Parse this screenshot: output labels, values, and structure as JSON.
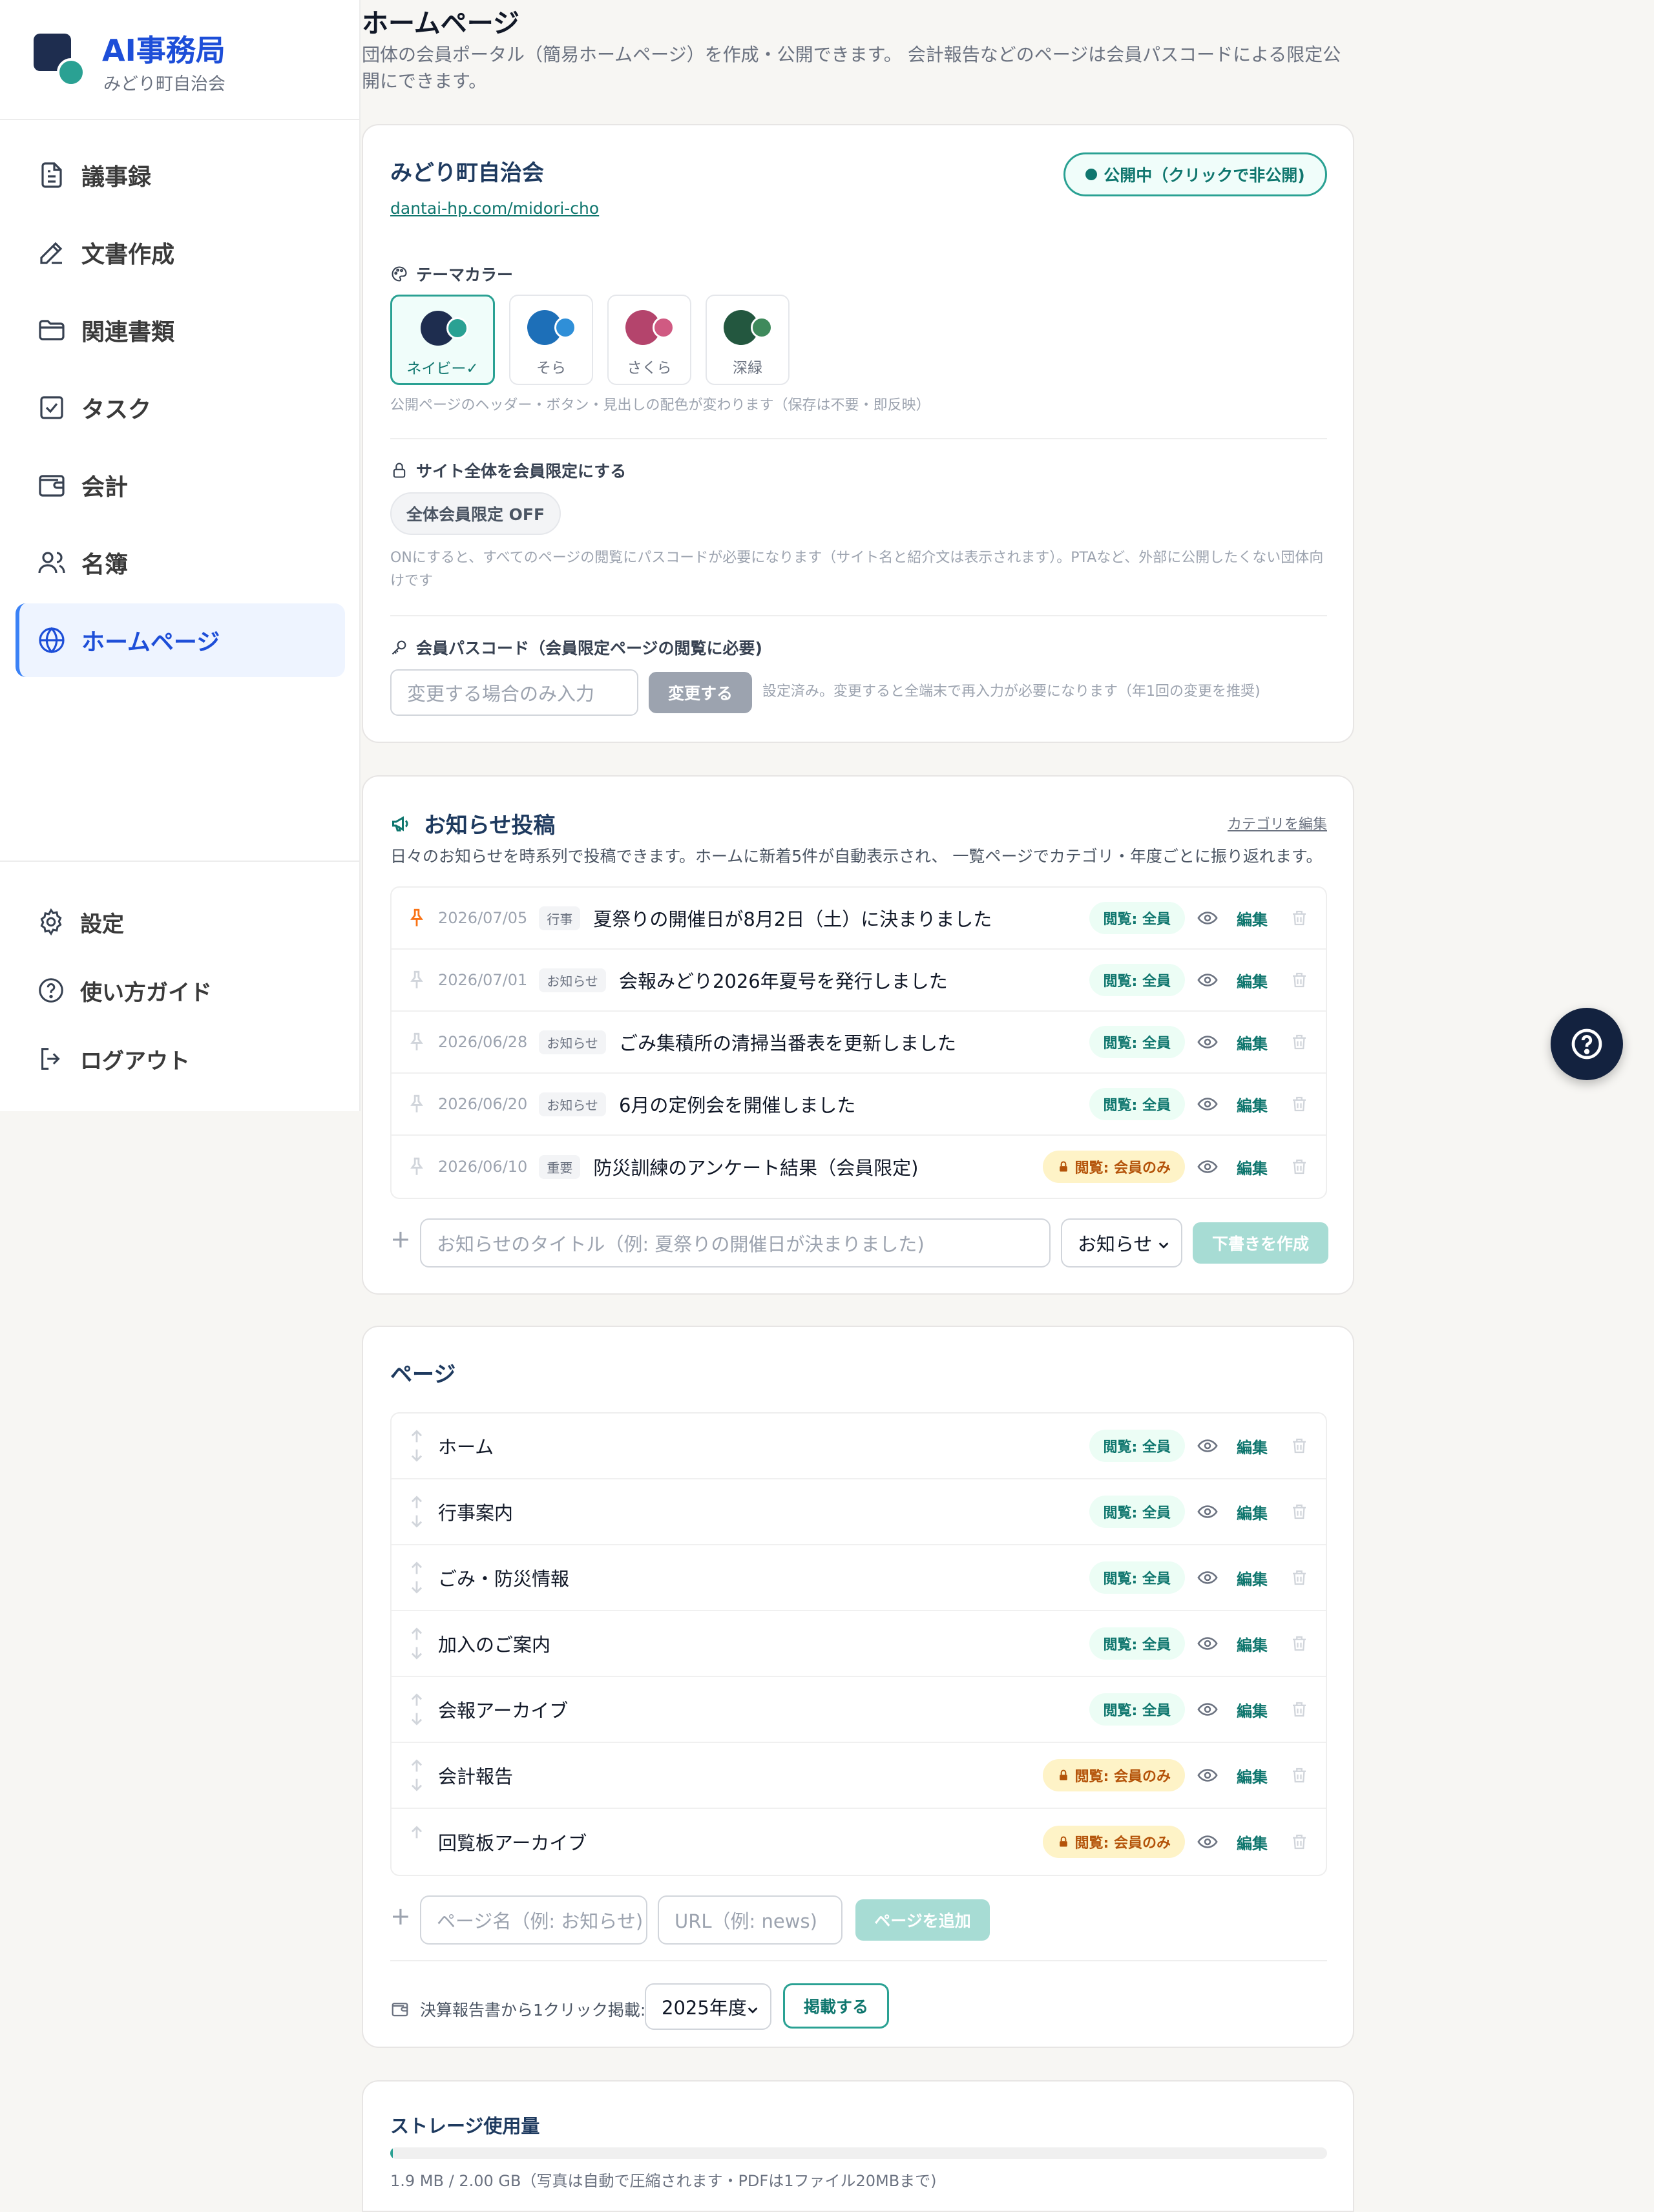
{
  "sidebar": {
    "brand": {
      "title": "AI事務局",
      "subtitle": "みどり町自治会"
    },
    "items": [
      {
        "label": "議事録",
        "icon": "document-icon"
      },
      {
        "label": "文書作成",
        "icon": "pen-icon"
      },
      {
        "label": "関連書類",
        "icon": "folder-icon"
      },
      {
        "label": "タスク",
        "icon": "checkbox-icon"
      },
      {
        "label": "会計",
        "icon": "wallet-icon"
      },
      {
        "label": "名簿",
        "icon": "users-icon"
      },
      {
        "label": "ホームページ",
        "icon": "globe-icon",
        "active": true
      }
    ],
    "bottom_items": [
      {
        "label": "設定",
        "icon": "gear-icon"
      },
      {
        "label": "使い方ガイド",
        "icon": "help-circle-icon"
      },
      {
        "label": "ログアウト",
        "icon": "logout-icon"
      }
    ]
  },
  "header": {
    "title": "ホームページ",
    "description": "団体の会員ポータル（簡易ホームページ）を作成・公開できます。 会計報告などのページは会員パスコードによる限定公開にできます。"
  },
  "site": {
    "name": "みどり町自治会",
    "url": "dantai-hp.com/midori-cho",
    "publish_label": "公開中（クリックで非公開)",
    "theme_label": "テーマカラー",
    "themes": [
      {
        "label": "ネイビー✓",
        "primary": "#1e2d4f",
        "accent": "#2aa193",
        "selected": true
      },
      {
        "label": "そら",
        "primary": "#1d6fb8",
        "accent": "#2f8fd8"
      },
      {
        "label": "さくら",
        "primary": "#b4446c",
        "accent": "#d05a82"
      },
      {
        "label": "深緑",
        "primary": "#23573f",
        "accent": "#3f8a5c"
      }
    ],
    "theme_hint": "公開ページのヘッダー・ボタン・見出しの配色が変わります（保存は不要・即反映）",
    "member_only_label": "サイト全体を会員限定にする",
    "member_only_toggle": "全体会員限定 OFF",
    "member_only_hint": "ONにすると、すべてのページの閲覧にパスコードが必要になります（サイト名と紹介文は表示されます）。PTAなど、外部に公開したくない団体向けです",
    "passcode_label": "会員パスコード（会員限定ページの閲覧に必要)",
    "passcode_placeholder": "変更する場合のみ入力",
    "passcode_button": "変更する",
    "passcode_hint": "設定済み。変更すると全端末で再入力が必要になります（年1回の変更を推奨)"
  },
  "news": {
    "title": "お知らせ投稿",
    "edit_categories": "カテゴリを編集",
    "description": "日々のお知らせを時系列で投稿できます。ホームに新着5件が自動表示され、 一覧ページでカテゴリ・年度ごとに振り返れます。",
    "items": [
      {
        "date": "2026/07/05",
        "category": "行事",
        "title": "夏祭りの開催日が8月2日（土）に決まりました",
        "access": "閲覧: 全員",
        "member_only": false,
        "pinned": true
      },
      {
        "date": "2026/07/01",
        "category": "お知らせ",
        "title": "会報みどり2026年夏号を発行しました",
        "access": "閲覧: 全員",
        "member_only": false,
        "pinned": false
      },
      {
        "date": "2026/06/28",
        "category": "お知らせ",
        "title": "ごみ集積所の清掃当番表を更新しました",
        "access": "閲覧: 全員",
        "member_only": false,
        "pinned": false
      },
      {
        "date": "2026/06/20",
        "category": "お知らせ",
        "title": "6月の定例会を開催しました",
        "access": "閲覧: 全員",
        "member_only": false,
        "pinned": false
      },
      {
        "date": "2026/06/10",
        "category": "重要",
        "title": "防災訓練のアンケート結果（会員限定)",
        "access": "閲覧: 会員のみ",
        "member_only": true,
        "pinned": false
      }
    ],
    "edit_label": "編集",
    "new_placeholder": "お知らせのタイトル（例: 夏祭りの開催日が決まりました)",
    "new_category": "お知らせ",
    "create_button": "下書きを作成"
  },
  "pages": {
    "title": "ページ",
    "items": [
      {
        "title": "ホーム",
        "access": "閲覧: 全員",
        "member_only": false
      },
      {
        "title": "行事案内",
        "access": "閲覧: 全員",
        "member_only": false
      },
      {
        "title": "ごみ・防災情報",
        "access": "閲覧: 全員",
        "member_only": false
      },
      {
        "title": "加入のご案内",
        "access": "閲覧: 全員",
        "member_only": false
      },
      {
        "title": "会報アーカイブ",
        "access": "閲覧: 全員",
        "member_only": false
      },
      {
        "title": "会計報告",
        "access": "閲覧: 会員のみ",
        "member_only": true
      },
      {
        "title": "回覧板アーカイブ",
        "access": "閲覧: 会員のみ",
        "member_only": true
      }
    ],
    "edit_label": "編集",
    "name_placeholder": "ページ名（例: お知らせ)",
    "url_placeholder": "URL（例: news)",
    "add_button": "ページを追加",
    "financial_label": "決算報告書から1クリック掲載:",
    "financial_year": "2025年度",
    "publish_button": "掲載する"
  },
  "storage": {
    "title": "ストレージ使用量",
    "usage_text": "1.9 MB / 2.00 GB（写真は自動で圧縮されます・PDFは1ファイル20MBまで)",
    "used_fraction": 0.001
  },
  "colors": {
    "brand_blue": "#1d4ed8",
    "teal": "#0f766e",
    "navy": "#13223f"
  }
}
